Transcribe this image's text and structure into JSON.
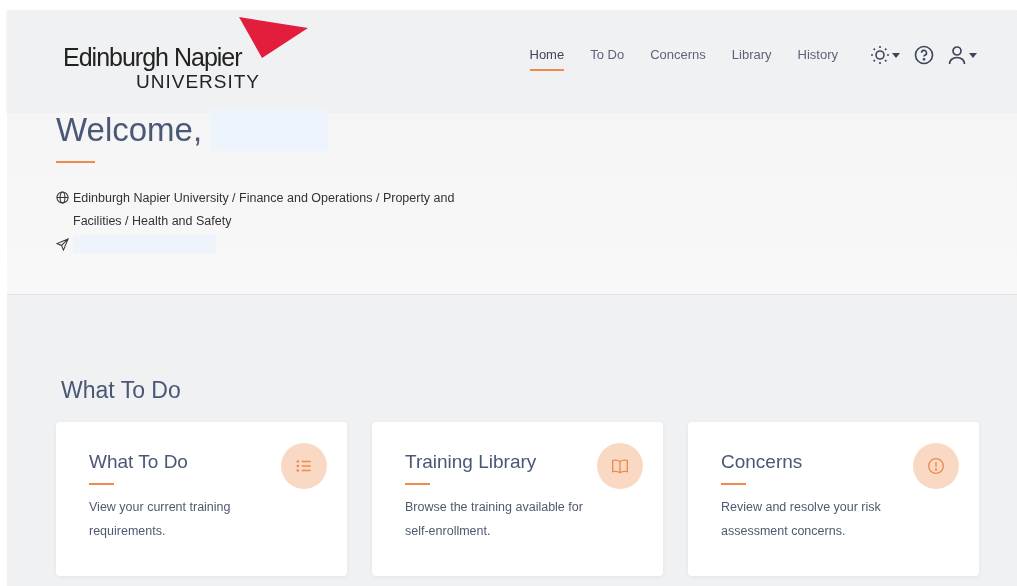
{
  "logo": {
    "name": "Edinburgh Napier",
    "subtitle": "UNIVERSITY"
  },
  "nav": [
    {
      "label": "Home",
      "selected": true
    },
    {
      "label": "To Do",
      "selected": false
    },
    {
      "label": "Concerns",
      "selected": false
    },
    {
      "label": "Library",
      "selected": false
    },
    {
      "label": "History",
      "selected": false
    }
  ],
  "welcome": {
    "greeting": "Welcome,",
    "organisation": "Edinburgh Napier University / Finance and Operations / Property and Facilities / Health and Safety"
  },
  "section": {
    "title": "What To Do"
  },
  "cards": [
    {
      "kind": "list",
      "title": "What To Do",
      "text": "View your current training requirements."
    },
    {
      "kind": "book",
      "title": "Training Library",
      "text": "Browse the training available for self-enrollment."
    },
    {
      "kind": "alert",
      "title": "Concerns",
      "text": "Review and resolve your risk assessment concerns."
    }
  ]
}
